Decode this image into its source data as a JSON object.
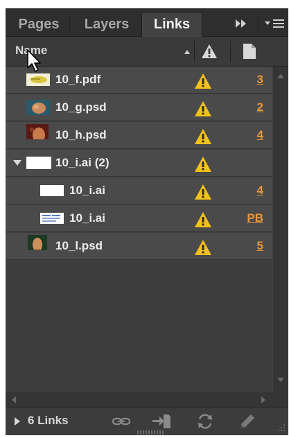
{
  "tabs": {
    "pages": "Pages",
    "layers": "Layers",
    "links": "Links"
  },
  "header": {
    "name": "Name"
  },
  "rows": [
    {
      "name": "10_f.pdf",
      "page": "3",
      "thumb": "pdf-thumb"
    },
    {
      "name": "10_g.psd",
      "page": "2",
      "thumb": "photo-thumb"
    },
    {
      "name": "10_h.psd",
      "page": "4",
      "thumb": "photo-thumb"
    },
    {
      "name": "10_i.ai (2)",
      "page": "",
      "thumb": "white-thumb"
    },
    {
      "name": "10_i.ai",
      "page": "4",
      "thumb": "white-thumb"
    },
    {
      "name": "10_i.ai",
      "page": "PB",
      "thumb": "text-thumb"
    },
    {
      "name": "10_l.psd",
      "page": "5",
      "thumb": "photo-thumb"
    }
  ],
  "footer": {
    "count": "6 Links"
  },
  "colors": {
    "panel": "#424242",
    "row": "#4a4a4a",
    "warning": "#f2c218",
    "page_link": "#e8973c"
  }
}
